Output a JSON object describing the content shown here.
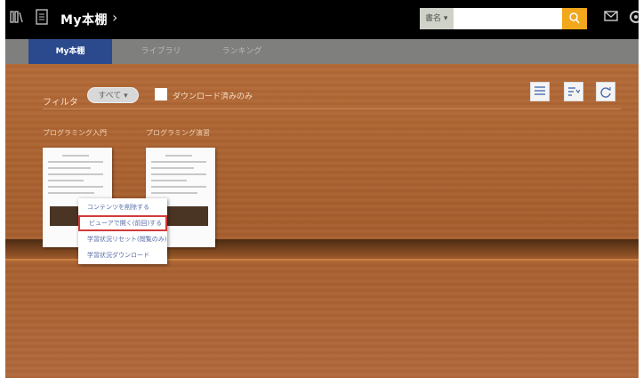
{
  "topbar": {
    "title": "My本棚",
    "search_select": "書名",
    "search_placeholder": "",
    "icons": [
      "books-icon",
      "document-icon",
      "mail-icon",
      "settings-icon"
    ]
  },
  "tabs": [
    {
      "label": "My本棚",
      "active": true
    },
    {
      "label": "ライブラリ",
      "active": false
    },
    {
      "label": "ランキング",
      "active": false
    }
  ],
  "filter": {
    "label": "フィルタ",
    "value": "すべて ▾",
    "download_only_label": "ダウンロード済みのみ"
  },
  "books": [
    {
      "title": "プログラミング入門"
    },
    {
      "title": "プログラミング演習"
    }
  ],
  "context_menu": [
    {
      "label": "コンテンツを削除する",
      "selected": false
    },
    {
      "label": "ビューアで開く(前回)する",
      "selected": true
    },
    {
      "label": "学習状況リセット(閲覧のみ)",
      "selected": false
    },
    {
      "label": "学習状況ダウンロード",
      "selected": false
    }
  ],
  "colors": {
    "accent": "#2b4a8e",
    "search_button": "#f2a81c",
    "highlight": "#d23b3b"
  }
}
